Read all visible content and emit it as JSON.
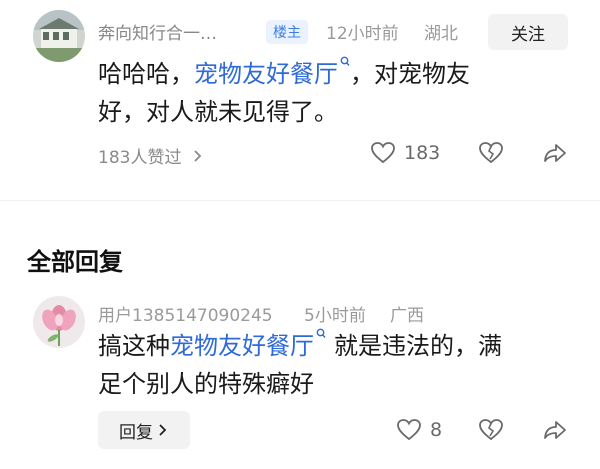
{
  "main_comment": {
    "username": "奔向知行合一…",
    "badge": "楼主",
    "time": "12小时前",
    "location": "湖北",
    "follow_label": "关注",
    "text_before": "哈哈哈，",
    "link_text": "宠物友好餐厅",
    "text_after_line1": "，对宠物友",
    "text_line2": "好，对人就未见得了。",
    "liked_by": "183人赞过",
    "like_count": "183"
  },
  "replies_section": {
    "title": "全部回复"
  },
  "reply": {
    "username": "用户1385147090245",
    "time": "5小时前",
    "location": "广西",
    "text_before": "搞这种",
    "link_text": "宠物友好餐厅",
    "text_after_line1": "就是违法的，满",
    "text_line2": "足个别人的特殊癖好",
    "reply_label": "回复",
    "like_count": "8"
  },
  "icons": {
    "search_link": "magnifier-icon",
    "like": "heart-outline-icon",
    "dislike": "broken-heart-icon",
    "share": "share-arrow-icon",
    "chevron": "chevron-right-icon"
  },
  "colors": {
    "link": "#2f6ad9",
    "badge_bg": "#eaf2fe",
    "badge_text": "#3c7de6",
    "meta": "#9a9a9a"
  }
}
